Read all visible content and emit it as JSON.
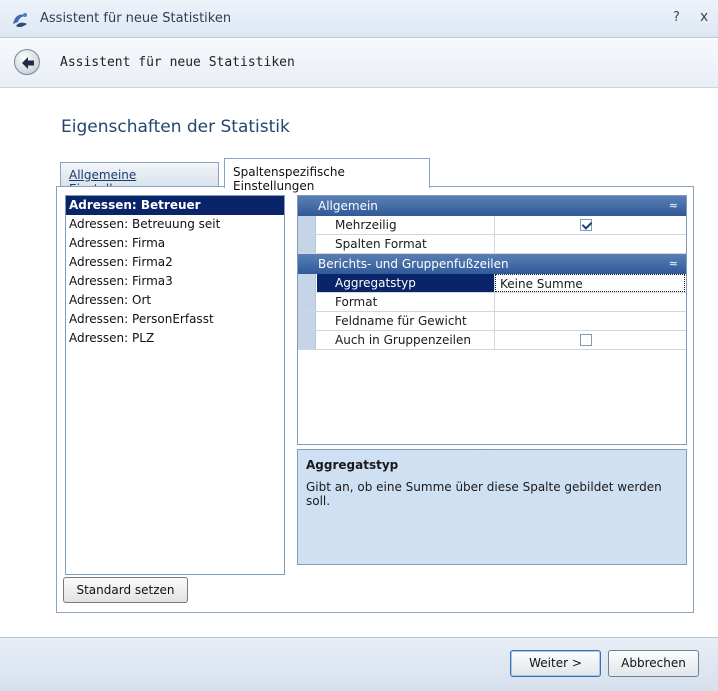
{
  "window": {
    "title": "Assistent für neue Statistiken",
    "help_glyph": "?",
    "close_glyph": "x"
  },
  "header": {
    "title": "Assistent für neue Statistiken"
  },
  "page": {
    "title": "Eigenschaften der Statistik"
  },
  "tabs": [
    {
      "label": "Allgemeine Einstellungen",
      "active": false
    },
    {
      "label": "Spaltenspezifische Einstellungen",
      "active": true
    }
  ],
  "columns": [
    "Adressen: Betreuer",
    "Adressen: Betreuung seit",
    "Adressen: Firma",
    "Adressen: Firma2",
    "Adressen: Firma3",
    "Adressen: Ort",
    "Adressen: PersonErfasst",
    "Adressen: PLZ"
  ],
  "selected_column_index": 0,
  "standard_button": "Standard setzen",
  "properties": {
    "group1": {
      "label": "Allgemein",
      "rows": [
        {
          "name": "Mehrzeilig",
          "checked": true
        },
        {
          "name": "Spalten Format",
          "value": ""
        }
      ]
    },
    "group2": {
      "label": "Berichts- und Gruppenfußzeilen",
      "rows": [
        {
          "name": "Aggregatstyp",
          "value": "Keine Summe"
        },
        {
          "name": "Format",
          "value": ""
        },
        {
          "name": "Feldname für Gewicht",
          "value": ""
        },
        {
          "name": "Auch in Gruppenzeilen",
          "checked": false
        }
      ]
    },
    "collapse_glyph": "≈",
    "splitter_grip": "....."
  },
  "description": {
    "title": "Aggregatstyp",
    "text": "Gibt an, ob eine Summe über diese Spalte gebildet werden soll."
  },
  "footer": {
    "next_label": "Weiter >",
    "cancel_label": "Abbrechen"
  },
  "colors": {
    "selection": "#0a246a",
    "group_header": "#2f5a98",
    "description_bg": "#cfe0f3"
  }
}
